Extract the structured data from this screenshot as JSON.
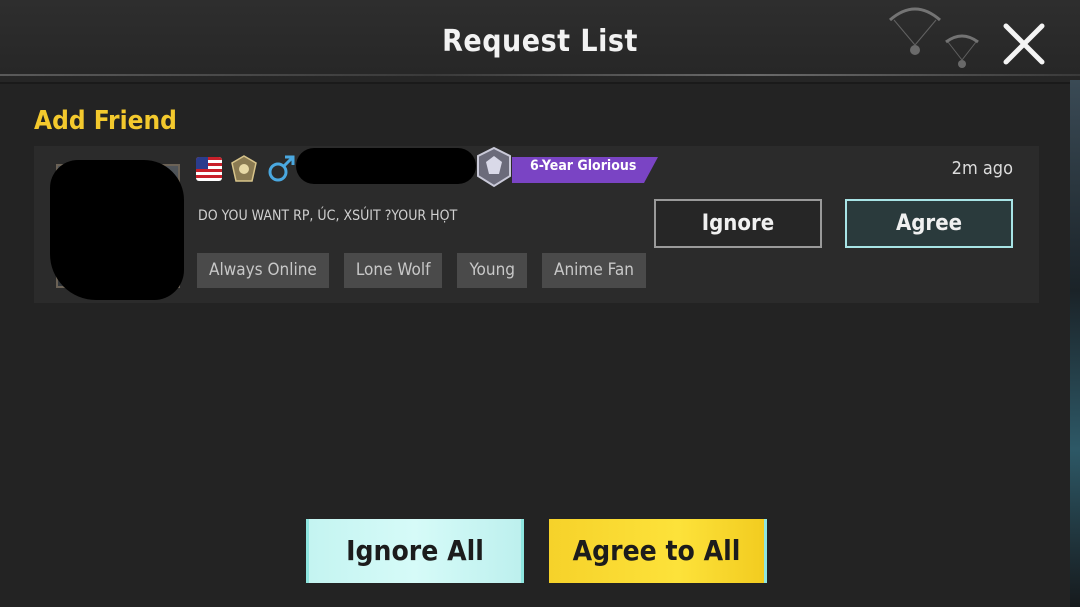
{
  "header": {
    "title": "Request List",
    "close_icon": "close-icon"
  },
  "section": {
    "title": "Add Friend"
  },
  "requests": [
    {
      "flag_icon": "us-flag-icon",
      "rank_icon": "rank-emblem-icon",
      "gender_icon": "male-icon",
      "badge": {
        "icon": "laurel-emblem-icon",
        "label": "6-Year Glorious",
        "color": "#7a44c4"
      },
      "bio": "DO YOU WANT RP, ÚC, XSÚIT ?YOUR HỌT",
      "tags": [
        "Always Online",
        "Lone Wolf",
        "Young",
        "Anime Fan"
      ],
      "time": "2m ago",
      "ignore_label": "Ignore",
      "agree_label": "Agree"
    }
  ],
  "footer": {
    "ignore_all_label": "Ignore All",
    "agree_all_label": "Agree to All"
  },
  "colors": {
    "accent_yellow": "#f3c92d",
    "accent_cyan": "#a8e4e6",
    "badge_purple": "#7a44c4"
  }
}
